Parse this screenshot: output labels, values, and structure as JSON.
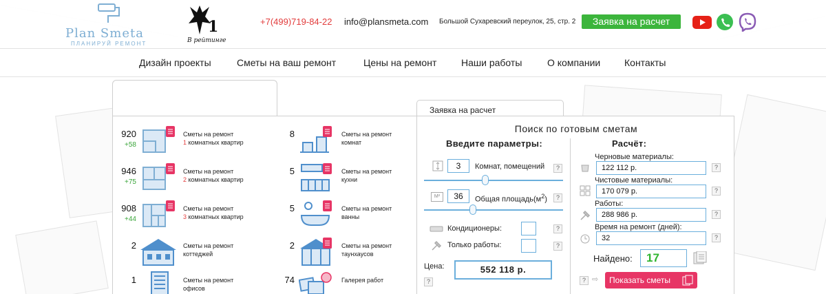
{
  "header": {
    "logo_title": "Plan Smeta",
    "logo_subtitle": "ПЛАНИРУЙ РЕМОНТ",
    "rating_number": "1",
    "rating_text": "В рейтинге",
    "phone": "+7(499)719-84-22",
    "email": "info@plansmeta.com",
    "address": "Большой Сухаревский переулок, 25, стр. 2",
    "cta_label": "Заявка на расчет",
    "social": [
      {
        "icon": "youtube-icon",
        "color": "#e62117"
      },
      {
        "icon": "whatsapp-icon",
        "color": "#3bbf52"
      },
      {
        "icon": "viber-icon",
        "color": "#8a5bb4"
      }
    ]
  },
  "nav": {
    "items": [
      "Дизайн проекты",
      "Сметы на ваш ремонт",
      "Цены на ремонт",
      "Наши работы",
      "О компании",
      "Контакты"
    ]
  },
  "categories": {
    "items": [
      {
        "count": "920",
        "delta": "+58",
        "line1": "Сметы на ремонт",
        "num": "1",
        "line2": " комнатных квартир",
        "icon": "plan-1room-icon"
      },
      {
        "count": "946",
        "delta": "+75",
        "line1": "Сметы на ремонт",
        "num": "2",
        "line2": " комнатных квартир",
        "icon": "plan-2room-icon"
      },
      {
        "count": "908",
        "delta": "+44",
        "line1": "Сметы на ремонт",
        "num": "3",
        "line2": " комнатных квартир",
        "icon": "plan-3room-icon"
      },
      {
        "count": "2",
        "delta": "",
        "line1": "Сметы на ремонт",
        "num": "",
        "line2": "коттеджей",
        "icon": "cottage-icon"
      },
      {
        "count": "1",
        "delta": "",
        "line1": "Сметы на ремонт",
        "num": "",
        "line2": "офисов",
        "icon": "office-icon"
      },
      {
        "count": "8",
        "delta": "",
        "line1": "Сметы на ремонт",
        "num": "",
        "line2": "комнат",
        "icon": "room-icon"
      },
      {
        "count": "5",
        "delta": "",
        "line1": "Сметы на ремонт",
        "num": "",
        "line2": "кухни",
        "icon": "kitchen-icon"
      },
      {
        "count": "5",
        "delta": "",
        "line1": "Сметы на ремонт",
        "num": "",
        "line2": "ванны",
        "icon": "bathroom-icon"
      },
      {
        "count": "2",
        "delta": "",
        "line1": "Сметы на ремонт",
        "num": "",
        "line2": "таунхаусов",
        "icon": "townhouse-icon"
      },
      {
        "count": "74",
        "delta": "",
        "line1": "Галерея работ",
        "num": "",
        "line2": "",
        "icon": "gallery-icon"
      }
    ]
  },
  "search": {
    "tab_label": "Заявка на расчет",
    "title": "Поиск по готовым сметам",
    "params_head": "Введите параметры:",
    "rooms_value": "3",
    "rooms_label": "Комнат, помещений",
    "rooms_slider": 0.44,
    "area_unit": "M²",
    "area_value": "36",
    "area_label_main": "Общая площадь(м",
    "area_label_sup": "2",
    "area_label_end": ")",
    "area_slider": 0.35,
    "ac_label": "Кондиционеры:",
    "works_label": "Только работы:",
    "price_label": "Цена:",
    "price_value": "552 118 р.",
    "qmark": "?",
    "calc_head": "Расчёт:",
    "rough_label": "Черновые материалы:",
    "rough_value": "122 112 р.",
    "finish_label": "Чистовые материалы:",
    "finish_value": "170 079 р.",
    "works_cost_label": "Работы:",
    "works_cost_value": "288 986 р.",
    "time_label": "Время на ремонт (дней):",
    "time_value": "32",
    "found_label": "Найдено:",
    "found_value": "17",
    "show_label": "Показать сметы"
  }
}
